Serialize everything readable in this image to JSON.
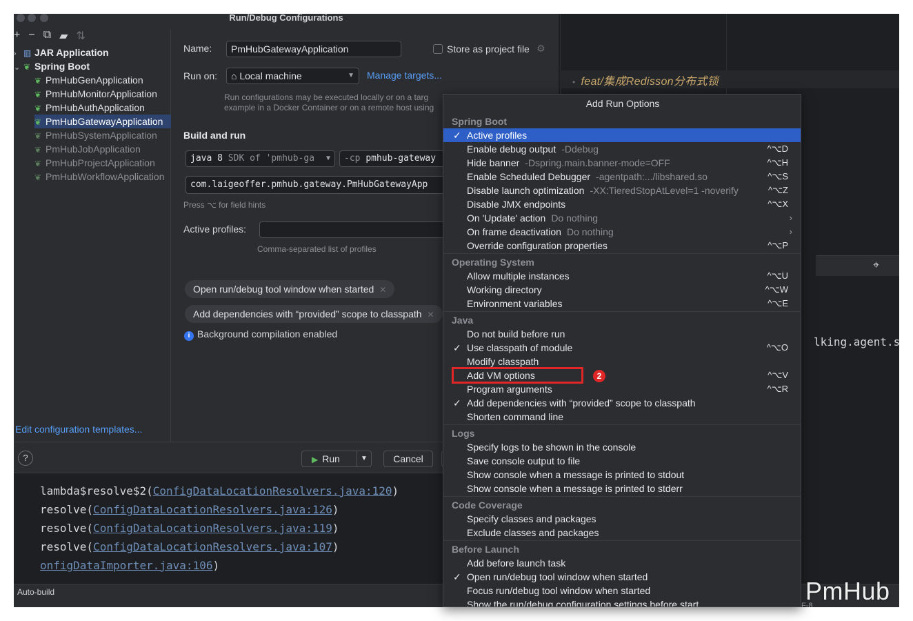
{
  "dialog": {
    "title": "Run/Debug Configurations",
    "toolbar_icons": [
      "plus-icon",
      "minus-icon",
      "copy-icon",
      "folder-icon",
      "sort-icon"
    ],
    "tree": {
      "jar_application": "JAR Application",
      "spring_boot": "Spring Boot",
      "apps": [
        {
          "label": "PmHubGenApplication",
          "dim": false,
          "selected": false
        },
        {
          "label": "PmHubMonitorApplication",
          "dim": false,
          "selected": false
        },
        {
          "label": "PmHubAuthApplication",
          "dim": false,
          "selected": false
        },
        {
          "label": "PmHubGatewayApplication",
          "dim": false,
          "selected": true
        },
        {
          "label": "PmHubSystemApplication",
          "dim": true,
          "selected": false
        },
        {
          "label": "PmHubJobApplication",
          "dim": true,
          "selected": false
        },
        {
          "label": "PmHubProjectApplication",
          "dim": true,
          "selected": false
        },
        {
          "label": "PmHubWorkflowApplication",
          "dim": true,
          "selected": false
        }
      ]
    },
    "edit_templates": "Edit configuration templates...",
    "form": {
      "name_label": "Name:",
      "name_value": "PmHubGatewayApplication",
      "store_label": "Store as project file",
      "run_on_label": "Run on:",
      "run_on_value": "Local machine",
      "manage_targets": "Manage targets...",
      "run_on_hint_1": "Run configurations may be executed locally or on a targ",
      "run_on_hint_2": "example in a Docker Container or on a remote host using",
      "build_and_run": "Build and run",
      "jdk_value": "java 8",
      "jdk_hint": "SDK of 'pmhub-ga",
      "cp_prefix": "-cp",
      "cp_value": "pmhub-gateway",
      "main_class": "com.laigeoffer.pmhub.gateway.PmHubGatewayApp",
      "field_hint": "Press ⌥ for field hints",
      "active_profiles_label": "Active profiles:",
      "profiles_hint": "Comma-separated list of profiles",
      "chip_1": "Open run/debug tool window when started",
      "chip_2": "Add dependencies with “provided” scope to classpath",
      "bg_compilation": "Background compilation enabled"
    },
    "buttons": {
      "help": "?",
      "run": "Run",
      "cancel": "Cancel"
    }
  },
  "editor": {
    "branch": "feat/集成Redisson分布式锁",
    "right_text": "lking.agent.serv",
    "console": [
      {
        "prefix": "lambda$resolve$2(",
        "link": "ConfigDataLocationResolvers.java:120",
        "suffix": ")"
      },
      {
        "prefix": "resolve(",
        "link": "ConfigDataLocationResolvers.java:126",
        "suffix": ")"
      },
      {
        "prefix": "resolve(",
        "link": "ConfigDataLocationResolvers.java:119",
        "suffix": ")"
      },
      {
        "prefix": "resolve(",
        "link": "ConfigDataLocationResolvers.java:107",
        "suffix": ")"
      },
      {
        "prefix": "",
        "link": "onfigDataImporter.java:106",
        "suffix": ")"
      }
    ],
    "status_left": "Auto-build",
    "encoding": "F-8",
    "watermark": "PmHub"
  },
  "popup": {
    "title": "Add Run Options",
    "groups": [
      {
        "name": "Spring Boot",
        "options": [
          {
            "label": "Active profiles",
            "sub": "",
            "shortcut": "",
            "checked": true,
            "selected": true,
            "submenu": false
          },
          {
            "label": "Enable debug output",
            "sub": "-Ddebug",
            "shortcut": "^⌥D",
            "checked": false,
            "selected": false,
            "submenu": false
          },
          {
            "label": "Hide banner",
            "sub": "-Dspring.main.banner-mode=OFF",
            "shortcut": "^⌥H",
            "checked": false,
            "selected": false,
            "submenu": false
          },
          {
            "label": "Enable Scheduled Debugger",
            "sub": "-agentpath:.../libshared.so",
            "shortcut": "^⌥S",
            "checked": false,
            "selected": false,
            "submenu": false
          },
          {
            "label": "Disable launch optimization",
            "sub": "-XX:TieredStopAtLevel=1 -noverify",
            "shortcut": "^⌥Z",
            "checked": false,
            "selected": false,
            "submenu": false
          },
          {
            "label": "Disable JMX endpoints",
            "sub": "",
            "shortcut": "^⌥X",
            "checked": false,
            "selected": false,
            "submenu": false
          },
          {
            "label": "On 'Update' action",
            "sub": "Do nothing",
            "shortcut": "",
            "checked": false,
            "selected": false,
            "submenu": true
          },
          {
            "label": "On frame deactivation",
            "sub": "Do nothing",
            "shortcut": "",
            "checked": false,
            "selected": false,
            "submenu": true
          },
          {
            "label": "Override configuration properties",
            "sub": "",
            "shortcut": "^⌥P",
            "checked": false,
            "selected": false,
            "submenu": false
          }
        ]
      },
      {
        "name": "Operating System",
        "options": [
          {
            "label": "Allow multiple instances",
            "sub": "",
            "shortcut": "^⌥U",
            "checked": false,
            "selected": false,
            "submenu": false
          },
          {
            "label": "Working directory",
            "sub": "",
            "shortcut": "^⌥W",
            "checked": false,
            "selected": false,
            "submenu": false
          },
          {
            "label": "Environment variables",
            "sub": "",
            "shortcut": "^⌥E",
            "checked": false,
            "selected": false,
            "submenu": false
          }
        ]
      },
      {
        "name": "Java",
        "options": [
          {
            "label": "Do not build before run",
            "sub": "",
            "shortcut": "",
            "checked": false,
            "selected": false,
            "submenu": false
          },
          {
            "label": "Use classpath of module",
            "sub": "",
            "shortcut": "^⌥O",
            "checked": true,
            "selected": false,
            "submenu": false
          },
          {
            "label": "Modify classpath",
            "sub": "",
            "shortcut": "",
            "checked": false,
            "selected": false,
            "submenu": false
          },
          {
            "label": "Add VM options",
            "sub": "",
            "shortcut": "^⌥V",
            "checked": false,
            "selected": false,
            "submenu": false
          },
          {
            "label": "Program arguments",
            "sub": "",
            "shortcut": "^⌥R",
            "checked": false,
            "selected": false,
            "submenu": false
          },
          {
            "label": "Add dependencies with “provided” scope to classpath",
            "sub": "",
            "shortcut": "",
            "checked": true,
            "selected": false,
            "submenu": false
          },
          {
            "label": "Shorten command line",
            "sub": "",
            "shortcut": "",
            "checked": false,
            "selected": false,
            "submenu": false
          }
        ]
      },
      {
        "name": "Logs",
        "options": [
          {
            "label": "Specify logs to be shown in the console",
            "sub": "",
            "shortcut": "",
            "checked": false,
            "selected": false,
            "submenu": false
          },
          {
            "label": "Save console output to file",
            "sub": "",
            "shortcut": "",
            "checked": false,
            "selected": false,
            "submenu": false
          },
          {
            "label": "Show console when a message is printed to stdout",
            "sub": "",
            "shortcut": "",
            "checked": false,
            "selected": false,
            "submenu": false
          },
          {
            "label": "Show console when a message is printed to stderr",
            "sub": "",
            "shortcut": "",
            "checked": false,
            "selected": false,
            "submenu": false
          }
        ]
      },
      {
        "name": "Code Coverage",
        "options": [
          {
            "label": "Specify classes and packages",
            "sub": "",
            "shortcut": "",
            "checked": false,
            "selected": false,
            "submenu": false
          },
          {
            "label": "Exclude classes and packages",
            "sub": "",
            "shortcut": "",
            "checked": false,
            "selected": false,
            "submenu": false
          }
        ]
      },
      {
        "name": "Before Launch",
        "options": [
          {
            "label": "Add before launch task",
            "sub": "",
            "shortcut": "",
            "checked": false,
            "selected": false,
            "submenu": false
          },
          {
            "label": "Open run/debug tool window when started",
            "sub": "",
            "shortcut": "",
            "checked": true,
            "selected": false,
            "submenu": false
          },
          {
            "label": "Focus run/debug tool window when started",
            "sub": "",
            "shortcut": "",
            "checked": false,
            "selected": false,
            "submenu": false
          },
          {
            "label": "Show the run/debug configuration settings before start",
            "sub": "",
            "shortcut": "",
            "checked": false,
            "selected": false,
            "submenu": false
          }
        ]
      }
    ],
    "annotation_badge": "2"
  }
}
